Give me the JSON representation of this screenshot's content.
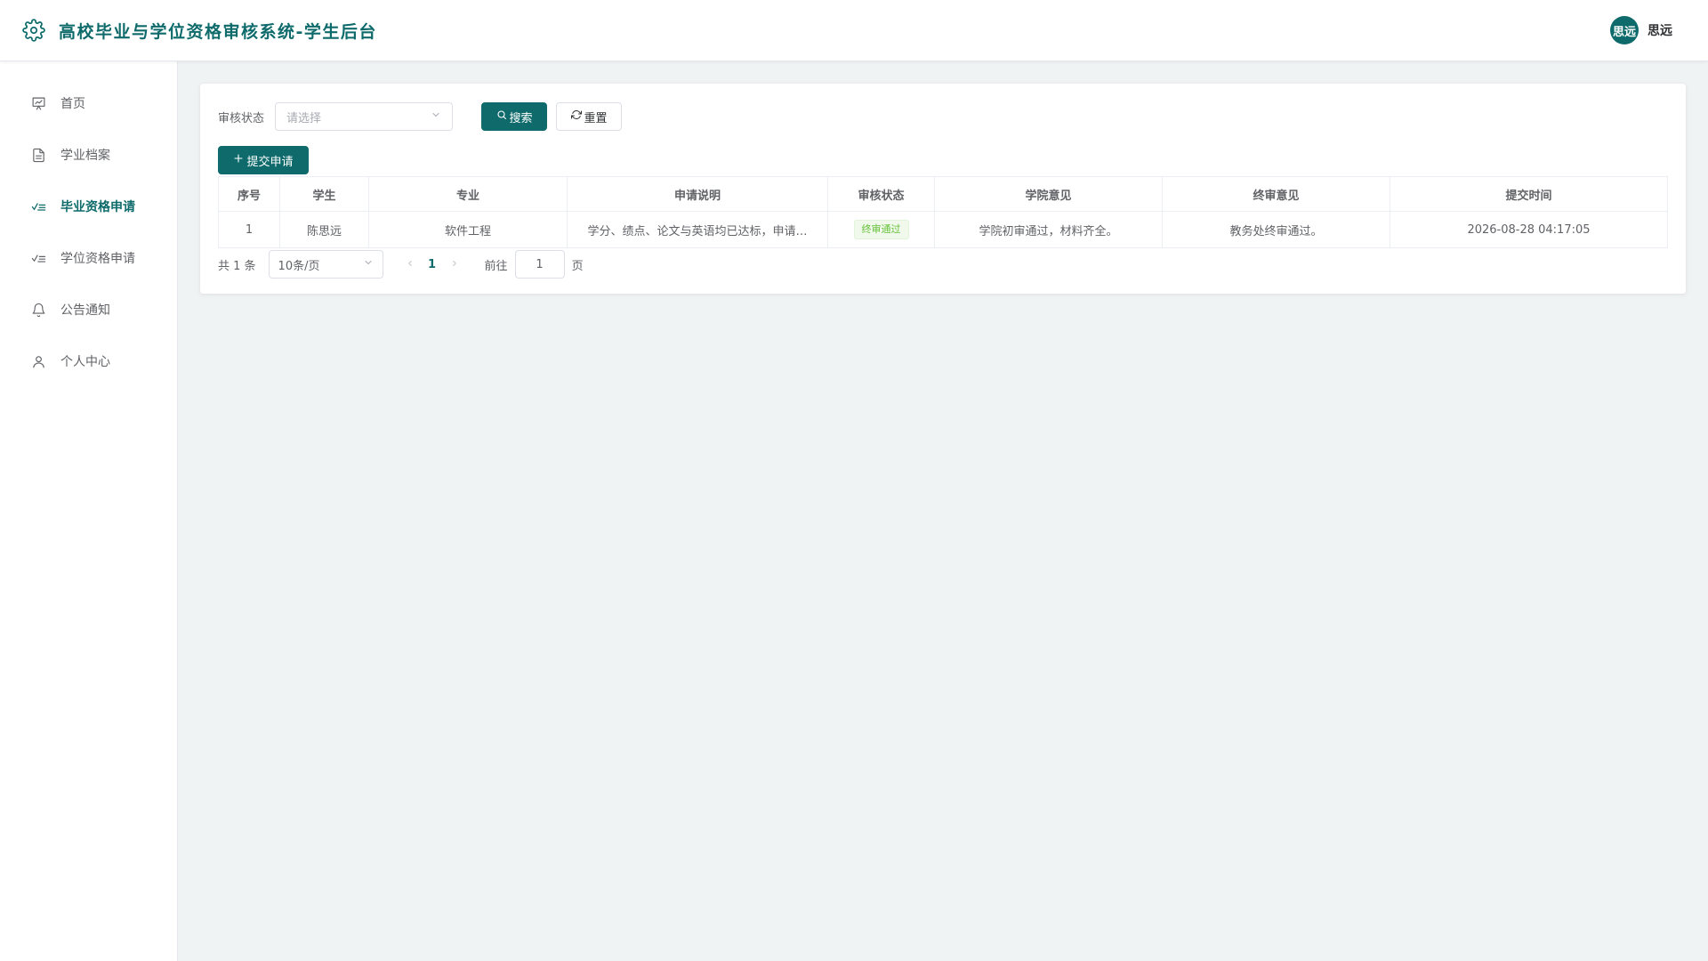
{
  "header": {
    "title": "高校毕业与学位资格审核系统-学生后台",
    "avatar_text": "思远",
    "username": "思远"
  },
  "sidebar": {
    "items": [
      {
        "label": "首页",
        "icon": "presentation-icon"
      },
      {
        "label": "学业档案",
        "icon": "document-icon"
      },
      {
        "label": "毕业资格申请",
        "icon": "checklist-icon",
        "active": true
      },
      {
        "label": "学位资格申请",
        "icon": "checklist-icon"
      },
      {
        "label": "公告通知",
        "icon": "bell-icon"
      },
      {
        "label": "个人中心",
        "icon": "user-icon"
      }
    ]
  },
  "filter": {
    "status_label": "审核状态",
    "status_placeholder": "请选择",
    "search_label": "搜索",
    "reset_label": "重置"
  },
  "toolbar": {
    "add_label": "提交申请"
  },
  "table": {
    "columns": [
      "序号",
      "学生",
      "专业",
      "申请说明",
      "审核状态",
      "学院意见",
      "终审意见",
      "提交时间"
    ],
    "rows": [
      {
        "index": "1",
        "student": "陈思远",
        "major": "软件工程",
        "description": "学分、绩点、论文与英语均已达标，申请…",
        "status": "终审通过",
        "college_opinion": "学院初审通过，材料齐全。",
        "final_opinion": "教务处终审通过。",
        "submit_time": "2026-08-28 04:17:05"
      }
    ]
  },
  "pagination": {
    "total_text": "共 1 条",
    "page_size": "10条/页",
    "current_page": "1",
    "goto_label": "前往",
    "goto_value": "1",
    "page_unit": "页"
  },
  "colors": {
    "primary": "#0f6b6b",
    "success": "#67c23a"
  }
}
